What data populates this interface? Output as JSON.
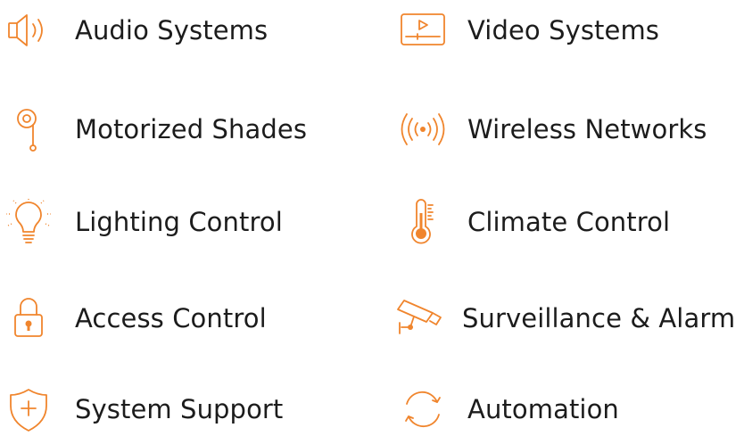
{
  "accent_color": "#f0852d",
  "text_color": "#1c1c1c",
  "services": [
    {
      "label": "Audio Systems",
      "icon": "speaker-icon"
    },
    {
      "label": "Video Systems",
      "icon": "video-player-icon"
    },
    {
      "label": "Motorized Shades",
      "icon": "shade-pulley-icon"
    },
    {
      "label": "Wireless Networks",
      "icon": "wireless-signal-icon"
    },
    {
      "label": "Lighting Control",
      "icon": "light-bulb-icon"
    },
    {
      "label": "Climate Control",
      "icon": "thermometer-icon"
    },
    {
      "label": "Access Control",
      "icon": "padlock-icon"
    },
    {
      "label": "Surveillance & Alarm",
      "icon": "security-camera-icon"
    },
    {
      "label": "System Support",
      "icon": "shield-plus-icon"
    },
    {
      "label": "Automation",
      "icon": "cycle-arrows-icon"
    }
  ]
}
